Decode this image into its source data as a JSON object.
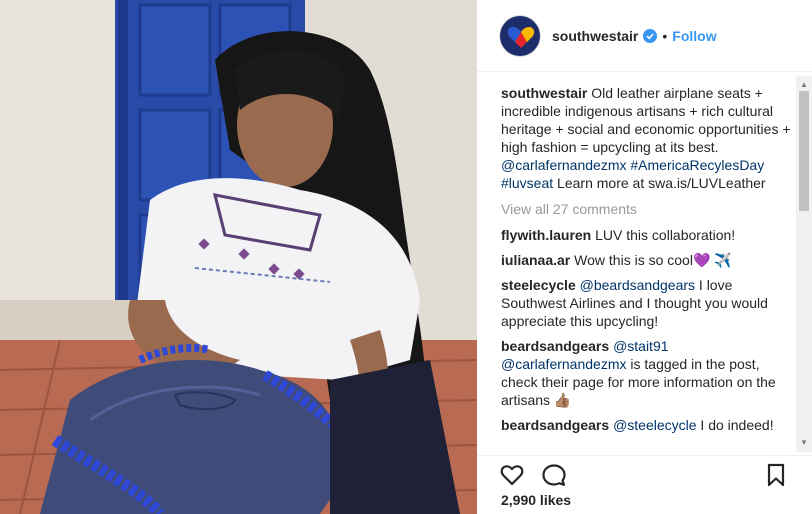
{
  "post": {
    "username": "southwestair",
    "follow_label": "Follow",
    "separator": "•",
    "caption": {
      "username": "southwestair",
      "text_1": "Old leather airplane seats + incredible indigenous artisans + rich cultural heritage + social and economic opportunities + high fashion = upcycling at its best.",
      "mention": "@carlafernandezmx",
      "hashtag_1": "#AmericaRecylesDay",
      "hashtag_2": "#luvseat",
      "text_2": "Learn more at swa.is/LUVLeather"
    },
    "view_all_label": "View all 27 comments",
    "comments": [
      {
        "username": "flywith.lauren",
        "text": "LUV this collaboration!"
      },
      {
        "username": "iulianaa.ar",
        "text": "Wow this is so cool💜 ✈️"
      },
      {
        "username": "steelecycle",
        "mention": "@beardsandgears",
        "text": "I love Southwest Airlines and I thought you would appreciate this upcycling!"
      },
      {
        "username": "beardsandgears",
        "mention": "@stait91",
        "mention_2": "@carlafernandezmx",
        "text": "is tagged in the post, check their page for more information on the artisans 👍🏽"
      },
      {
        "username": "beardsandgears",
        "mention": "@steelecycle",
        "text": "I do indeed!"
      }
    ],
    "likes": "2,990 likes"
  },
  "colors": {
    "link": "#003569",
    "follow": "#3897f0",
    "verified": "#3897f0",
    "muted": "#999999"
  },
  "icons": {
    "like": "heart-icon",
    "comment": "comment-bubble-icon",
    "save": "bookmark-icon",
    "verified": "verified-badge-icon"
  }
}
